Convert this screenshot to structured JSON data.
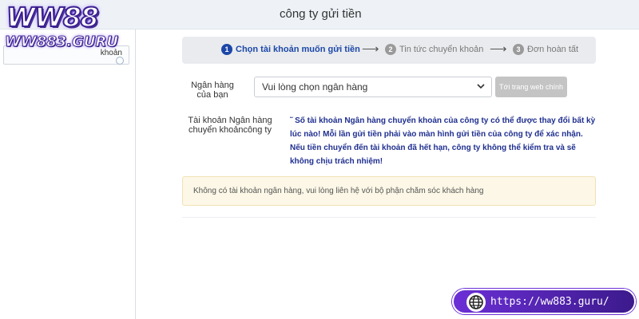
{
  "header": {
    "title": "công ty gửi tiền"
  },
  "logo": {
    "main": "WW88",
    "sub": "WW883.GURU"
  },
  "sidebar": {
    "items": [
      {
        "label": "khoản"
      }
    ]
  },
  "steps": [
    {
      "num": "1",
      "label": "Chọn tài khoản muốn gửi tiền",
      "active": true
    },
    {
      "num": "2",
      "label": "Tin tức chuyển khoản",
      "active": false
    },
    {
      "num": "3",
      "label": "Đơn hoàn tất",
      "active": false
    }
  ],
  "form": {
    "bank_label_line1": "Ngân hàng",
    "bank_label_line2": "của bạn",
    "bank_select_value": "Vui lòng chọn ngân hàng",
    "web_button": "Tới trang web chính",
    "account_label_line1": "Tài khoản Ngân hàng",
    "account_label_line2": "chuyển khoảncông ty",
    "notice": "˜ Số tài khoản Ngân hàng chuyển khoản của công ty có thể được thay đổi bất kỳ lúc nào! Mỗi lần gửi tiền phải vào màn hình gửi tiền của công ty để xác nhận. Nếu tiền chuyển đến tài khoản đã hết hạn, công ty không thể kiểm tra và sẽ không chịu trách nhiệm!"
  },
  "alert": {
    "text": "Không có tài khoản ngân hàng, vui lòng liên hệ với bộ phận chăm sóc khách hàng"
  },
  "watermark": {
    "url": "https://ww883.guru/"
  },
  "colors": {
    "accent": "#1c47a8",
    "notice_text": "#1f2f8f",
    "alert_bg": "#fcf7e6",
    "pill_purple": "#6b2fd6"
  }
}
